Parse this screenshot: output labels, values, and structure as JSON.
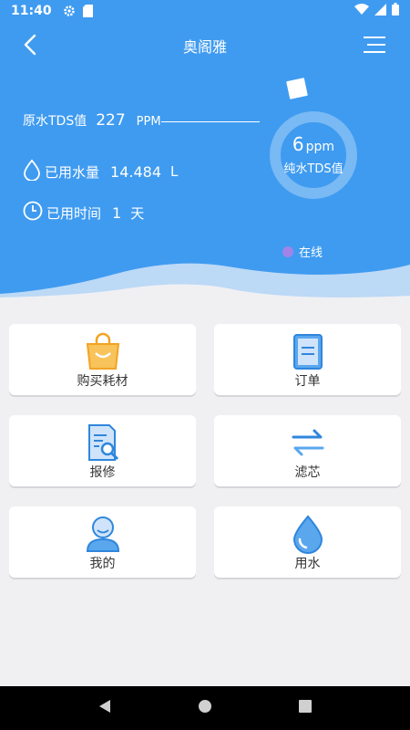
{
  "status_bar": {
    "time": "11:40"
  },
  "header": {
    "title": "奥阁雅"
  },
  "tds": {
    "label": "原水TDS值",
    "value": "227",
    "unit": "PPM"
  },
  "water_used": {
    "label": "已用水量",
    "value": "14.484",
    "unit": "L"
  },
  "time_used": {
    "label": "已用时间",
    "value": "1",
    "unit": "天"
  },
  "gauge": {
    "value": "6",
    "unit": "ppm",
    "label": "纯水TDS值"
  },
  "status": {
    "label": "在线",
    "color": "#a084e8"
  },
  "accent": "#3f9bf0",
  "cards": [
    {
      "label": "购买耗材",
      "icon": "shopping-bag-icon"
    },
    {
      "label": "订单",
      "icon": "order-icon"
    },
    {
      "label": "报修",
      "icon": "repair-icon"
    },
    {
      "label": "滤芯",
      "icon": "filter-swap-icon"
    },
    {
      "label": "我的",
      "icon": "user-icon"
    },
    {
      "label": "用水",
      "icon": "water-drop-icon"
    }
  ]
}
